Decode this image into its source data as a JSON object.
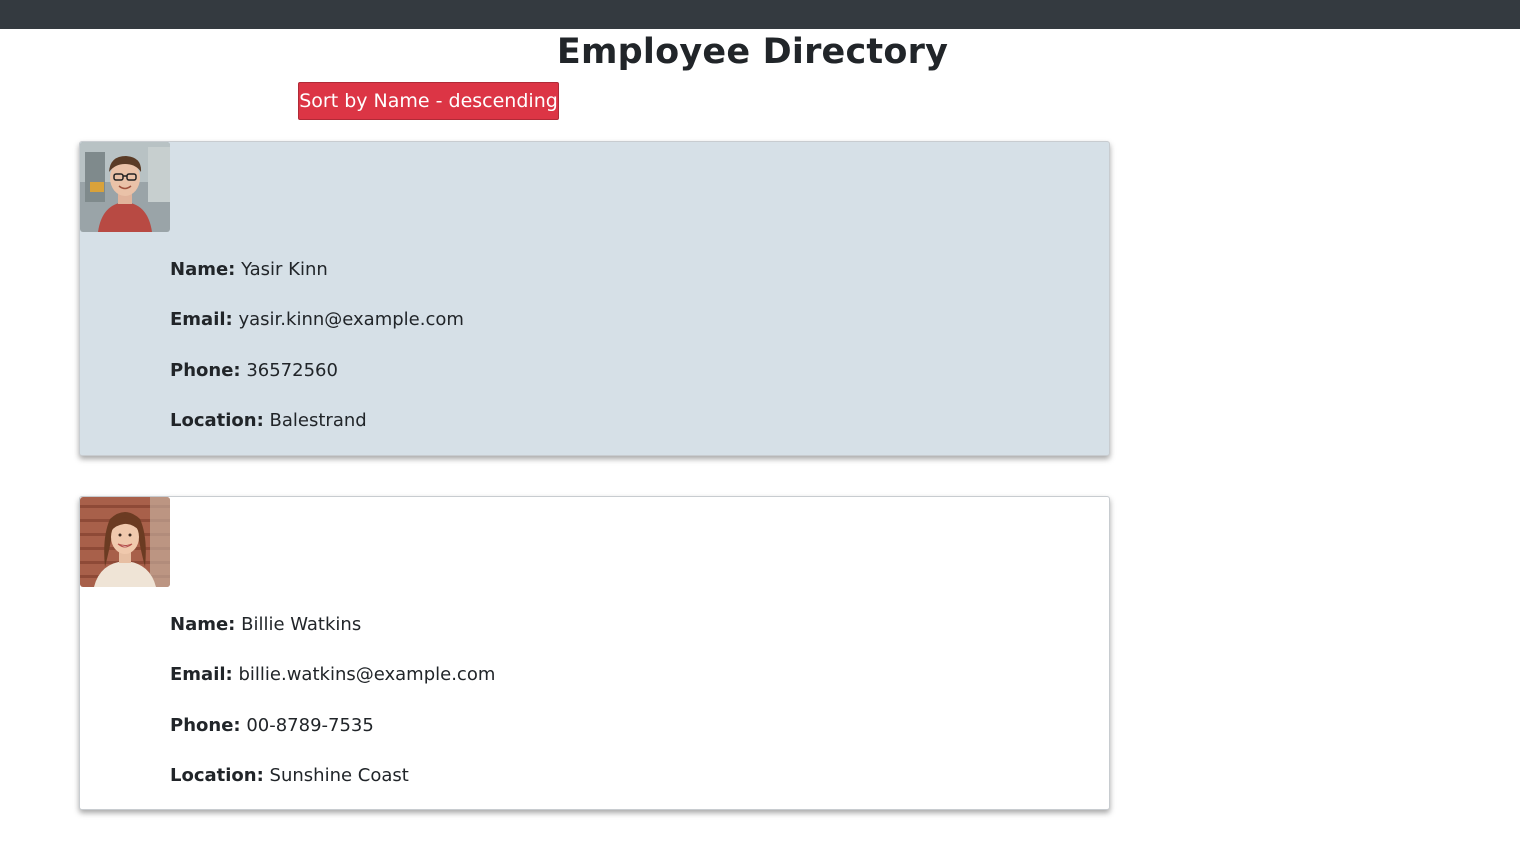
{
  "page": {
    "title": "Employee Directory"
  },
  "toolbar": {
    "sort_label": "Sort by Name - descending"
  },
  "labels": {
    "name": "Name:",
    "email": "Email:",
    "phone": "Phone:",
    "location": "Location:"
  },
  "employees": [
    {
      "name": "Yasir Kinn",
      "email": "yasir.kinn@example.com",
      "phone": "36572560",
      "location": "Balestrand"
    },
    {
      "name": "Billie Watkins",
      "email": "billie.watkins@example.com",
      "phone": "00-8789-7535",
      "location": "Sunshine Coast"
    }
  ],
  "colors": {
    "topbar": "#343a40",
    "sort_button": "#dc3545",
    "highlighted_card": "#d6e0e7"
  }
}
